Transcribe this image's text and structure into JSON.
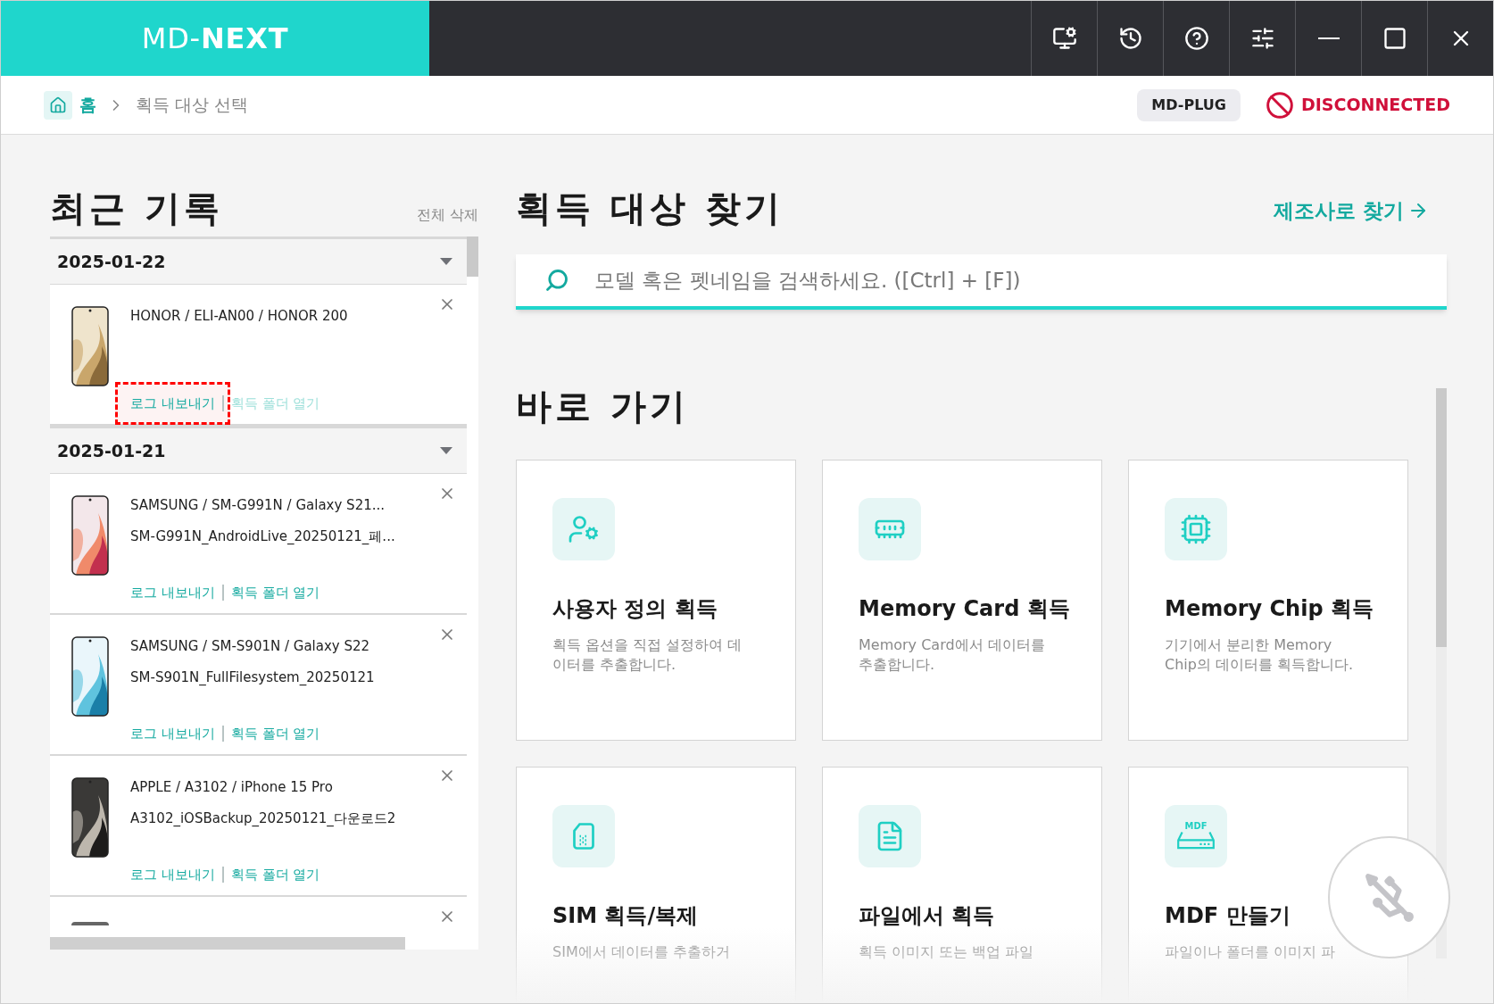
{
  "titlebar": {
    "logo_light": "MD-",
    "logo_bold": "NEXT",
    "buttons": [
      {
        "kind": "screen"
      },
      {
        "kind": "history"
      },
      {
        "kind": "help"
      },
      {
        "kind": "settings"
      },
      {
        "kind": "minimize"
      },
      {
        "kind": "maximize"
      },
      {
        "kind": "close"
      }
    ]
  },
  "breadcrumb": {
    "home": "홈",
    "current": "획득 대상 선택"
  },
  "device": {
    "label": "MD-PLUG"
  },
  "connection": {
    "text": "DISCONNECTED",
    "connected": false
  },
  "recent": {
    "title": "최근 기록",
    "clear": "전체 삭제",
    "groups": [
      {
        "date": "2025-01-22",
        "expanded": true,
        "records": [
          {
            "kind": "record",
            "device": "HONOR / ELI-AN00 / HONOR 200",
            "export": "로그 내보내기",
            "open": "획득 폴더 열기",
            "highlighted": true
          }
        ]
      },
      {
        "date": "2025-01-21",
        "expanded": true,
        "records": [
          {
            "kind": "record",
            "device": "SAMSUNG / SM-G991N / Galaxy S21...",
            "file": "SM-G991N_AndroidLive_20250121_페...",
            "export": "로그 내보내기",
            "open": "획득 폴더 열기",
            "highlighted": false
          },
          {
            "kind": "record",
            "device": "SAMSUNG / SM-S901N / Galaxy S22",
            "file": "SM-S901N_FullFilesystem_20250121",
            "export": "로그 내보내기",
            "open": "획득 폴더 열기",
            "highlighted": false
          },
          {
            "kind": "record",
            "device": "APPLE / A3102 / iPhone 15 Pro",
            "file": "A3102_iOSBackup_20250121_다운로드2",
            "export": "로그 내보내기",
            "open": "획득 폴더 열기",
            "highlighted": false
          },
          {
            "kind": "partial"
          }
        ]
      }
    ]
  },
  "search": {
    "title": "획득 대상 찾기",
    "maker_link": "제조사로 찾기",
    "placeholder": "모델 혹은 펫네임을 검색하세요. ([Ctrl] + [F])"
  },
  "shortcuts": {
    "title": "바로 가기",
    "cards": [
      {
        "kind": "custom",
        "title": "사용자 정의 획득",
        "description": "획득 옵션을 직접 설정하여 데이터를 추출합니다."
      },
      {
        "kind": "card",
        "title": "Memory Card 획득",
        "description": "Memory Card에서 데이터를 추출합니다."
      },
      {
        "kind": "chip",
        "title": "Memory Chip 획득",
        "description": "기기에서 분리한 Memory Chip의 데이터를 획득합니다."
      },
      {
        "kind": "sim",
        "title": "SIM 획득/복제",
        "description": "SIM에서 데이터를 추출하거"
      },
      {
        "kind": "file",
        "title": "파일에서 획득",
        "description": "획득 이미지 또는 백업 파일"
      },
      {
        "kind": "mdf",
        "title": "MDF 만들기",
        "description": "파일이나 폴더를 이미지 파",
        "icon_label": "MDF"
      }
    ]
  }
}
